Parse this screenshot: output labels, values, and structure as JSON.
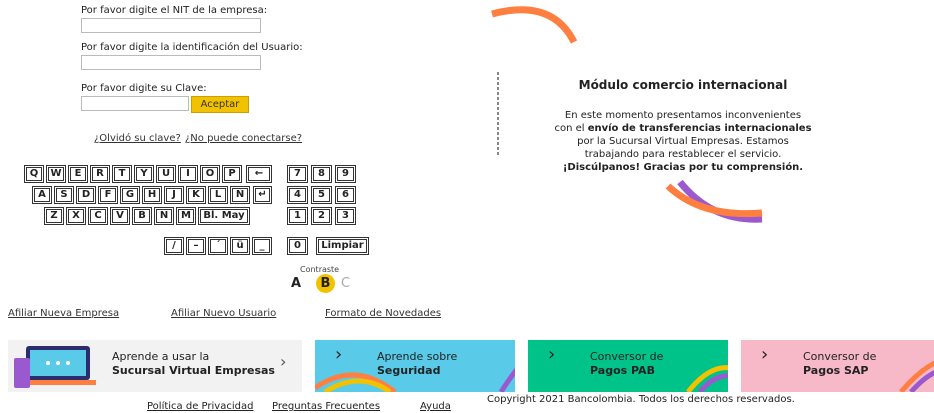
{
  "form": {
    "nit_label": "Por favor digite el NIT de la empresa:",
    "nit_value": "",
    "user_label": "Por favor digite la identificación del Usuario:",
    "user_value": "",
    "key_label": "Por favor digite su Clave:",
    "key_value": "",
    "accept_button": "Aceptar",
    "forgot_link": "¿Olvidó su clave?",
    "cant_connect_link": "¿No puede conectarse?"
  },
  "keyboard": {
    "row1": [
      "Q",
      "W",
      "E",
      "R",
      "T",
      "Y",
      "U",
      "I",
      "O",
      "P"
    ],
    "row2": [
      "A",
      "S",
      "D",
      "F",
      "G",
      "H",
      "J",
      "K",
      "L",
      "Ñ"
    ],
    "row3": [
      "Z",
      "X",
      "C",
      "V",
      "B",
      "N",
      "M"
    ],
    "caps": "Bl. May",
    "backspace": "←",
    "enter": "↵",
    "symbols": [
      "/",
      "–",
      "´",
      "ü",
      "_"
    ],
    "numpad": [
      [
        "7",
        "8",
        "9"
      ],
      [
        "4",
        "5",
        "6"
      ],
      [
        "1",
        "2",
        "3"
      ]
    ],
    "zero": "0",
    "clear": "Limpiar"
  },
  "contrast": {
    "label": "Contraste",
    "options": [
      "A",
      "B",
      "C"
    ],
    "selected": "B"
  },
  "links": {
    "affiliate_company": "Afiliar Nueva Empresa",
    "affiliate_user": "Afiliar Nuevo Usuario",
    "news_format": "Formato de Novedades"
  },
  "notice": {
    "title": "Módulo comercio internacional",
    "line1": "En este momento presentamos inconvenientes",
    "line2a": "con el ",
    "line2b": "envío de transferencias internacionales",
    "line3": "por la Sucursal Virtual Empresas. Estamos",
    "line4": "trabajando para restablecer el servicio.",
    "line5": "¡Discúlpanos! Gracias por tu comprensión."
  },
  "banners": [
    {
      "line1": "Aprende a usar la",
      "line2": "Sucursal Virtual Empresas",
      "bg": "#f2f2f2"
    },
    {
      "line1": "Aprende sobre",
      "line2": "Seguridad",
      "bg": "#59cbe8"
    },
    {
      "line1": "Conversor de",
      "line2": "Pagos PAB",
      "bg": "#00c389"
    },
    {
      "line1": "Conversor de",
      "line2": "Pagos SAP",
      "bg": "#f7b8c8"
    }
  ],
  "footer": {
    "privacy": "Política de Privacidad",
    "faq": "Preguntas Frecuentes",
    "help": "Ayuda",
    "copyright": "Copyright 2021 Bancolombia. Todos los derechos reservados."
  },
  "colors": {
    "accent_yellow": "#f2c200",
    "orange": "#ff7f41",
    "purple": "#9b59d0"
  }
}
